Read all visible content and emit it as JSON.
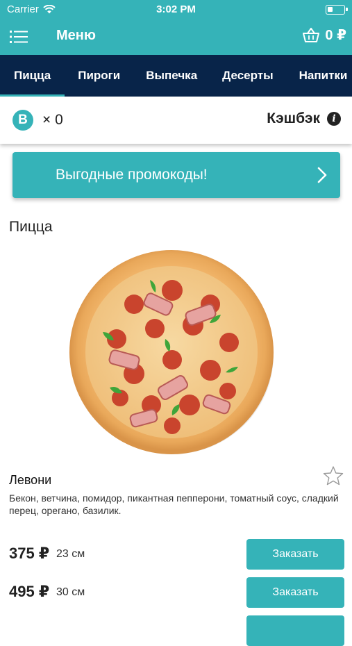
{
  "status_bar": {
    "carrier": "Carrier",
    "time": "3:02 PM"
  },
  "nav": {
    "title": "Меню",
    "cart_total": "0 ₽"
  },
  "tabs": [
    {
      "label": "Пицца",
      "active": true
    },
    {
      "label": "Пироги",
      "active": false
    },
    {
      "label": "Выпечка",
      "active": false
    },
    {
      "label": "Десерты",
      "active": false
    },
    {
      "label": "Напитки",
      "active": false
    }
  ],
  "bonus": {
    "badge": "B",
    "count": "× 0",
    "cashback_label": "Кэшбэк",
    "info_glyph": "i"
  },
  "promo": {
    "label": "Выгодные промокоды!"
  },
  "section": {
    "title": "Пицца"
  },
  "product": {
    "name": "Левони",
    "description": "Бекон, ветчина, помидор, пикантная пепперони, томатный соус, сладкий перец, орегано, базилик.",
    "options": [
      {
        "price": "375 ₽",
        "size": "23 см",
        "button": "Заказать"
      },
      {
        "price": "495 ₽",
        "size": "30 см",
        "button": "Заказать"
      }
    ]
  },
  "colors": {
    "accent": "#35b3b8",
    "tabs_bg": "#082449"
  }
}
